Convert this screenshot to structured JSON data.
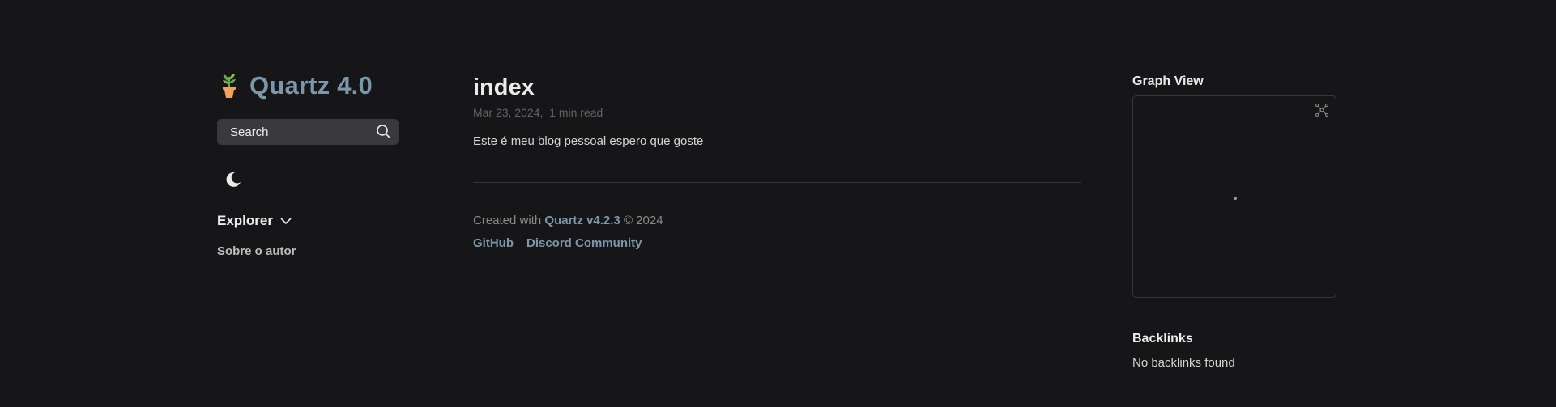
{
  "sidebar": {
    "site_title": "Quartz 4.0",
    "search_label": "Search",
    "explorer_title": "Explorer",
    "explorer_items": [
      "Sobre o autor"
    ]
  },
  "article": {
    "title": "index",
    "date": "Mar 23, 2024",
    "reading_time": "1 min read",
    "body": "Este é meu blog pessoal espero que goste"
  },
  "footer": {
    "created_with": "Created with",
    "quartz_link": "Quartz v4.2.3",
    "copyright": "© 2024",
    "links": [
      "GitHub",
      "Discord Community"
    ]
  },
  "graph": {
    "title": "Graph View"
  },
  "backlinks": {
    "title": "Backlinks",
    "empty_text": "No backlinks found"
  },
  "colors": {
    "background": "#161618",
    "accent": "#7b97aa",
    "node": "#84a59d"
  },
  "icons": {
    "site_logo": "potted-plant-icon",
    "search": "search-icon",
    "darkmode": "moon-icon",
    "explorer": "chevron-down-icon",
    "graph_expand": "global-graph-icon"
  }
}
